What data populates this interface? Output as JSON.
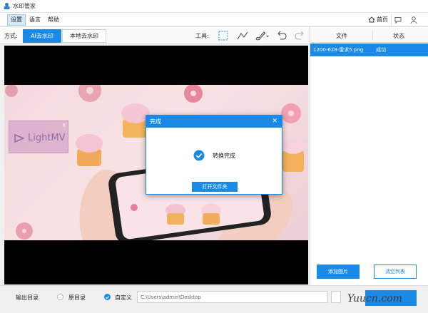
{
  "window": {
    "title": "水印管家"
  },
  "menu": {
    "items": [
      "设置",
      "语言",
      "帮助"
    ],
    "home_label": "首页"
  },
  "toolbar": {
    "mode_label": "方式:",
    "mode_ai": "AI去水印",
    "mode_local": "本地去水印",
    "tools_label": "工具:"
  },
  "preview": {
    "watermark_text": "LightMV",
    "watermark_close": "X"
  },
  "dialog": {
    "title": "完成",
    "close": "✕",
    "message": "转换完成",
    "open_folder_button": "打开文件夹"
  },
  "file_list": {
    "col_file": "文件",
    "col_status": "状态",
    "rows": [
      {
        "name": "1200-628-雷求5.png",
        "status": "成功"
      }
    ],
    "add_button": "添加图片",
    "clear_button": "清空列表"
  },
  "output": {
    "label": "输出目录",
    "option_original": "原目录",
    "option_custom": "自定义",
    "path": "C:\\Users\\admin\\Desktop",
    "selected": "自定义"
  },
  "brand_overlay": "Yuucn.com",
  "colors": {
    "accent": "#1b8ae6"
  },
  "icons": [
    "home-icon",
    "chat-icon",
    "user-icon",
    "rect-select-icon",
    "polyline-icon",
    "brush-icon",
    "undo-icon",
    "redo-icon",
    "check-circle-icon",
    "folder-icon"
  ]
}
